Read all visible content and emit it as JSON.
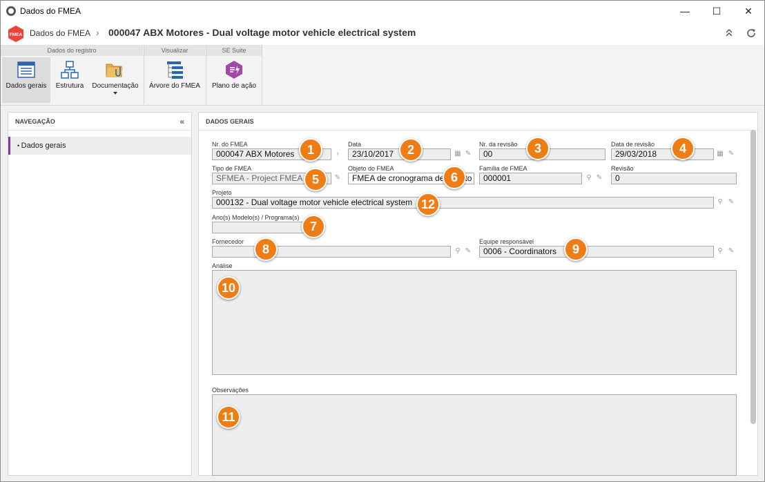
{
  "window": {
    "title": "Dados do FMEA",
    "minimize": "—",
    "maximize": "☐",
    "close": "✕"
  },
  "header": {
    "logo_text": "FMEA",
    "breadcrumb_root": "Dados do FMEA",
    "separator": "›",
    "record_title": "000047 ABX Motores - Dual voltage motor vehicle electrical system"
  },
  "ribbon": {
    "groups": [
      "Dados do registro",
      "Visualizar",
      "SE Suite"
    ],
    "buttons": {
      "dados_gerais": "Dados gerais",
      "estrutura": "Estrutura",
      "documentacao": "Documentação",
      "arvore": "Árvore do FMEA",
      "plano": "Plano de ação"
    }
  },
  "nav": {
    "title": "NAVEGAÇÃO",
    "collapse": "«",
    "items": [
      "Dados gerais"
    ]
  },
  "main": {
    "title": "DADOS GERAIS",
    "fields": {
      "nr_fmea": {
        "label": "Nr. do FMEA",
        "value": "000047 ABX Motores"
      },
      "data": {
        "label": "Data",
        "value": "23/10/2017"
      },
      "nr_revisao": {
        "label": "Nr. da revisão",
        "value": "00"
      },
      "data_revisao": {
        "label": "Data de revisão",
        "value": "29/03/2018"
      },
      "tipo": {
        "label": "Tipo de FMEA",
        "value": "SFMEA - Project FMEA"
      },
      "objeto": {
        "label": "Objeto do FMEA",
        "value": "FMEA de cronograma de projeto"
      },
      "familia": {
        "label": "Família de FMEA",
        "value": "000001"
      },
      "revisao": {
        "label": "Revisão",
        "value": "0"
      },
      "projeto": {
        "label": "Projeto",
        "value": "000132 - Dual voltage motor vehicle electrical system"
      },
      "anos": {
        "label": "Ano(s) Modelo(s) / Programa(s)",
        "value": ""
      },
      "fornecedor": {
        "label": "Fornecedor",
        "value": ""
      },
      "equipe": {
        "label": "Equipe responsável",
        "value": "0006 - Coordinators"
      },
      "analise": {
        "label": "Análise"
      },
      "observacoes": {
        "label": "Observações"
      }
    }
  },
  "badges": [
    "1",
    "2",
    "3",
    "4",
    "5",
    "6",
    "7",
    "8",
    "9",
    "10",
    "11",
    "12"
  ],
  "colors": {
    "badge": "#ef7d16",
    "accent": "#7b3aa0",
    "logo": "#e8463a"
  }
}
